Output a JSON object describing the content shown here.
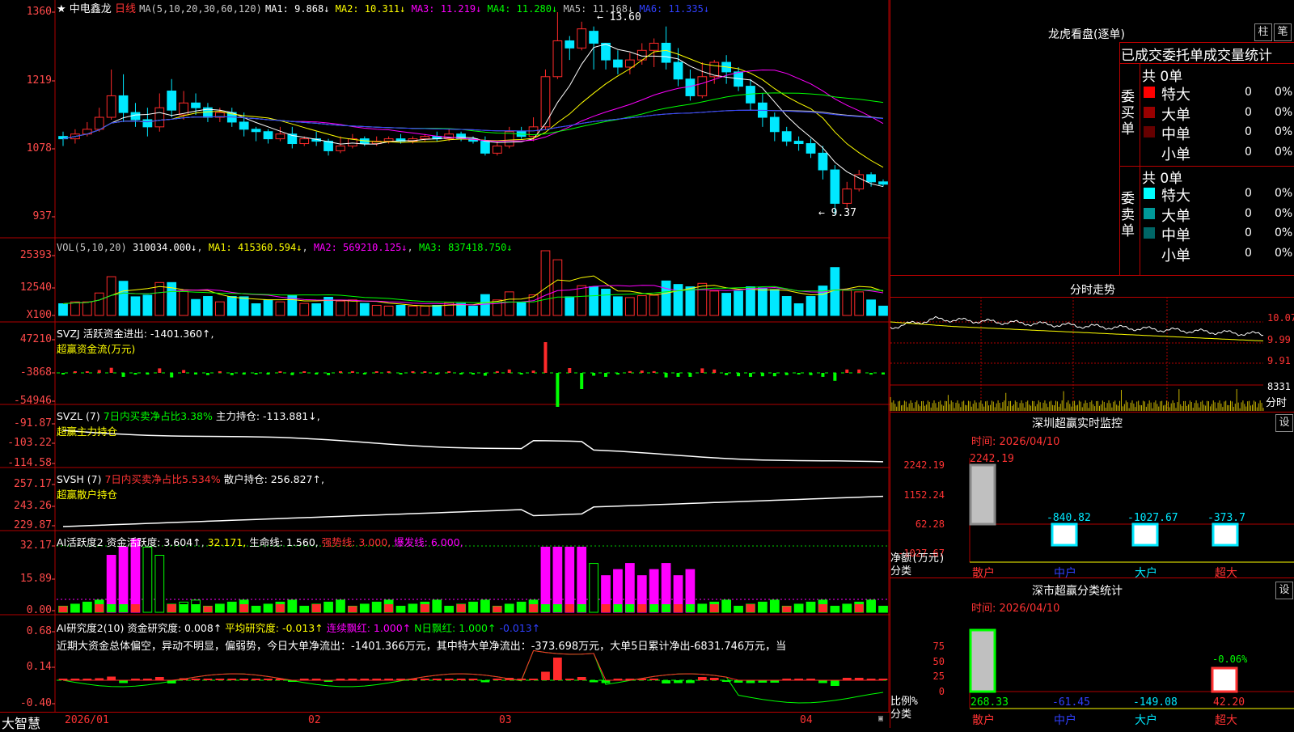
{
  "stock": {
    "name": "中电鑫龙",
    "period": "日线",
    "ma_label": "MA(5,10,20,30,60,120)",
    "ma": [
      {
        "label": "MA1: 9.868↓",
        "color": "#ffffff"
      },
      {
        "label": "MA2: 10.311↓",
        "color": "#ffff00"
      },
      {
        "label": "MA3: 11.219↓",
        "color": "#ff00ff"
      },
      {
        "label": "MA4: 11.280↓",
        "color": "#00ff00"
      },
      {
        "label": "MA5: 11.168↓",
        "color": "#c0c0c0"
      },
      {
        "label": "MA6: 11.335↓",
        "color": "#3040ff"
      }
    ],
    "high_mark": "13.60",
    "low_mark": "9.37"
  },
  "colors": {
    "up": "#ff2a2a",
    "down": "#00e8ff",
    "frame": "#b00000"
  },
  "panels": {
    "main_ticks": [
      "1360",
      "1219",
      "1078",
      "937"
    ],
    "vol": {
      "label": "VOL(5,10,20)",
      "value": "310034.000↓",
      "ma1": "MA1: 415360.594↓",
      "ma2": "MA2: 569210.125↓",
      "ma3": "MA3: 837418.750↓",
      "ticks": [
        "25393",
        "12540",
        "X100"
      ]
    },
    "svzj": {
      "label": "SVZJ  活跃资金进出: -1401.360↑,",
      "sub": "超赢资金流(万元)",
      "ticks": [
        "47210",
        "-3868",
        "-54946"
      ]
    },
    "svzl": {
      "label": "SVZL (7)",
      "l1": "7日内买卖净占比3.38%",
      "l2": "主力持仓: -113.881↓,",
      "sub": "超赢主力持仓",
      "ticks": [
        "-91.87",
        "-103.22",
        "-114.58"
      ]
    },
    "svsh": {
      "label": "SVSH (7)",
      "l1": "7日内买卖净占比5.534%",
      "l2": "散户持仓: 256.827↑,",
      "sub": "超赢散户持仓",
      "ticks": [
        "257.17",
        "243.26",
        "229.87"
      ]
    },
    "ai2": {
      "label": "AI活跃度2",
      "l1": "资金活跃度: 3.604↑",
      "l2": "32.171,",
      "l3": "生命线: 1.560,",
      "l4": "强势线: 3.000,",
      "l5": "爆发线: 6.000,",
      "ticks": [
        "32.17",
        "15.89",
        "0.00"
      ]
    },
    "ai3": {
      "label": "AI研究度2(10)",
      "l1": "资金研究度: 0.008↑",
      "l2": "平均研究度: -0.013↑",
      "l3": "连续飘红: 1.000↑",
      "l4": "N日飘红: 1.000↑",
      "l5": "-0.013↑",
      "note": "近期大资金总体偏空，异动不明显，偏弱势，今日大单净流出：-1401.366万元，其中特大单净流出：-373.698万元，大单5日累计净出-6831.746万元，当",
      "ticks": [
        "0.68",
        "0.14",
        "-0.40"
      ]
    }
  },
  "xaxis": [
    "2026/01",
    "02",
    "03",
    "04"
  ],
  "brand": "大智慧",
  "right": {
    "title": "龙虎看盘(逐单)",
    "btn1": "柱",
    "btn2": "笔",
    "stats_title": "已成交委托单成交量统计",
    "buy": {
      "header": "委买单",
      "total": "共 0单",
      "rows": [
        {
          "name": "特大",
          "count": "0",
          "pct": "0%",
          "color": "#ff0000"
        },
        {
          "name": "大单",
          "count": "0",
          "pct": "0%",
          "color": "#990000"
        },
        {
          "name": "中单",
          "count": "0",
          "pct": "0%",
          "color": "#660000"
        },
        {
          "name": "小单",
          "count": "0",
          "pct": "0%",
          "color": "#000000"
        }
      ]
    },
    "sell": {
      "header": "委卖单",
      "total": "共 0单",
      "rows": [
        {
          "name": "特大",
          "count": "0",
          "pct": "0%",
          "color": "#00ffff"
        },
        {
          "name": "大单",
          "count": "0",
          "pct": "0%",
          "color": "#009999"
        },
        {
          "name": "中单",
          "count": "0",
          "pct": "0%",
          "color": "#006666"
        },
        {
          "name": "小单",
          "count": "0",
          "pct": "0%",
          "color": "#000000"
        }
      ]
    },
    "intraday": {
      "title": "分时走势",
      "ticks": [
        "10.07",
        "9.99",
        "9.91"
      ],
      "vol_label": "8331",
      "vol_unit": "分时"
    },
    "sz_monitor": {
      "title": "深圳超赢实时监控",
      "set": "设",
      "time": "时间: 2026/04/10",
      "ticks": [
        "2242.19",
        "1152.24",
        "62.28",
        "-1027.67"
      ],
      "ylabel": "净额(万元)",
      "xlabel": "分类",
      "categories": [
        "散户",
        "中户",
        "大户",
        "超大"
      ],
      "values": [
        2242.19,
        -840.82,
        -1027.67,
        -373.7
      ],
      "value_labels": [
        "2242.19",
        "-840.82",
        "-1027.67",
        "-373.7"
      ]
    },
    "sz_class": {
      "title": "深市超赢分类统计",
      "set": "设",
      "time": "时间: 2026/04/10",
      "ticks": [
        "75",
        "50",
        "25",
        "0"
      ],
      "ylabel": "比例%",
      "xlabel": "分类",
      "categories": [
        "散户",
        "中户",
        "大户",
        "超大"
      ],
      "value_labels": [
        "268.33",
        "-61.45",
        "-149.08",
        "42.20"
      ],
      "top_label": "-0.06%"
    }
  },
  "chart_data": {
    "type": "candlestick",
    "title": "中电鑫龙 日线",
    "x_labels": [
      "2026/01",
      "02",
      "03",
      "04"
    ],
    "candles": [
      [
        11.0,
        10.95,
        11.1,
        10.8
      ],
      [
        10.95,
        11.05,
        11.15,
        10.85
      ],
      [
        11.05,
        11.15,
        11.3,
        11.0
      ],
      [
        11.15,
        11.4,
        11.6,
        11.1
      ],
      [
        11.4,
        11.85,
        12.4,
        11.35
      ],
      [
        11.85,
        11.5,
        12.3,
        11.3
      ],
      [
        11.5,
        11.35,
        11.7,
        11.2
      ],
      [
        11.35,
        11.2,
        11.6,
        11.0
      ],
      [
        11.2,
        11.6,
        11.9,
        11.1
      ],
      [
        11.95,
        11.55,
        12.2,
        11.4
      ],
      [
        11.45,
        11.7,
        11.95,
        11.35
      ],
      [
        11.7,
        11.6,
        11.9,
        11.45
      ],
      [
        11.6,
        11.4,
        11.7,
        11.3
      ],
      [
        11.4,
        11.5,
        11.6,
        11.3
      ],
      [
        11.5,
        11.3,
        11.6,
        11.2
      ],
      [
        11.3,
        11.15,
        11.5,
        11.0
      ],
      [
        11.15,
        11.1,
        11.2,
        10.9
      ],
      [
        11.1,
        10.95,
        11.15,
        10.85
      ],
      [
        10.95,
        11.05,
        11.2,
        10.9
      ],
      [
        11.05,
        10.85,
        11.2,
        10.75
      ],
      [
        10.85,
        10.95,
        11.0,
        10.8
      ],
      [
        10.95,
        10.9,
        11.1,
        10.8
      ],
      [
        10.9,
        10.7,
        10.95,
        10.6
      ],
      [
        10.7,
        10.8,
        11.0,
        10.65
      ],
      [
        10.8,
        10.95,
        11.05,
        10.75
      ],
      [
        10.95,
        10.85,
        11.0,
        10.8
      ],
      [
        10.85,
        10.9,
        11.0,
        10.8
      ],
      [
        10.9,
        10.95,
        11.0,
        10.85
      ],
      [
        10.95,
        10.9,
        11.05,
        10.85
      ],
      [
        10.9,
        10.95,
        11.0,
        10.85
      ],
      [
        10.95,
        11.0,
        11.05,
        10.9
      ],
      [
        11.0,
        10.95,
        11.1,
        10.9
      ],
      [
        10.95,
        11.05,
        11.15,
        10.9
      ],
      [
        11.05,
        10.95,
        11.1,
        10.9
      ],
      [
        10.95,
        10.9,
        11.0,
        10.85
      ],
      [
        10.9,
        10.65,
        11.0,
        10.6
      ],
      [
        10.65,
        10.8,
        10.9,
        10.6
      ],
      [
        10.8,
        11.1,
        11.2,
        10.75
      ],
      [
        11.1,
        11.0,
        11.2,
        10.95
      ],
      [
        11.0,
        11.2,
        11.4,
        10.9
      ],
      [
        11.2,
        12.25,
        12.4,
        11.15
      ],
      [
        12.25,
        13.0,
        13.6,
        12.2
      ],
      [
        13.0,
        12.85,
        13.1,
        12.6
      ],
      [
        12.85,
        13.25,
        13.4,
        12.8
      ],
      [
        13.2,
        12.95,
        13.3,
        12.4
      ],
      [
        12.95,
        12.6,
        12.9,
        12.4
      ],
      [
        12.6,
        12.45,
        12.8,
        12.3
      ],
      [
        12.45,
        12.6,
        12.75,
        12.3
      ],
      [
        12.6,
        12.8,
        12.95,
        12.5
      ],
      [
        12.8,
        12.95,
        13.05,
        12.45
      ],
      [
        12.95,
        12.55,
        13.3,
        12.4
      ],
      [
        12.55,
        12.2,
        12.85,
        12.05
      ],
      [
        12.2,
        11.85,
        12.4,
        11.75
      ],
      [
        11.85,
        12.25,
        12.55,
        11.8
      ],
      [
        12.25,
        12.55,
        12.6,
        12.1
      ],
      [
        12.55,
        12.35,
        12.7,
        12.1
      ],
      [
        12.35,
        12.05,
        12.45,
        11.95
      ],
      [
        12.05,
        11.7,
        12.2,
        11.55
      ],
      [
        11.7,
        11.4,
        11.9,
        11.2
      ],
      [
        11.4,
        11.1,
        11.5,
        10.9
      ],
      [
        11.1,
        10.9,
        11.2,
        10.8
      ],
      [
        10.9,
        10.85,
        11.0,
        10.7
      ],
      [
        10.85,
        10.65,
        10.95,
        10.55
      ],
      [
        10.65,
        10.3,
        10.8,
        10.1
      ],
      [
        10.3,
        9.6,
        10.4,
        9.37
      ],
      [
        9.6,
        9.9,
        10.05,
        9.5
      ],
      [
        9.9,
        10.2,
        10.3,
        9.85
      ],
      [
        10.2,
        10.05,
        10.25,
        9.95
      ],
      [
        10.05,
        10.0,
        10.1,
        9.95
      ]
    ]
  }
}
